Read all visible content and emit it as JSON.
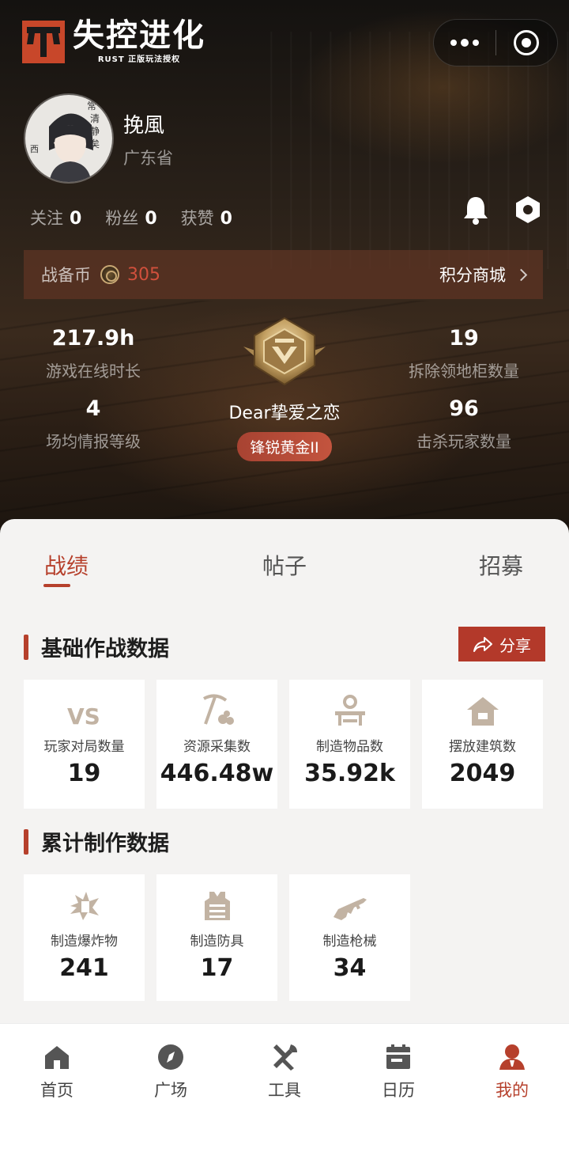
{
  "app": {
    "logo_title": "失控进化",
    "logo_subtitle": "RUST 正版玩法授权"
  },
  "profile": {
    "username": "挽風",
    "province": "广东省",
    "social": [
      {
        "label": "关注",
        "value": "0"
      },
      {
        "label": "粉丝",
        "value": "0"
      },
      {
        "label": "获赞",
        "value": "0"
      }
    ]
  },
  "coins": {
    "label": "战备币",
    "value": "305",
    "shop_label": "积分商城"
  },
  "stats": {
    "online_hours": {
      "value": "217.9h",
      "label": "游戏在线时长"
    },
    "cabinets": {
      "value": "19",
      "label": "拆除领地柜数量"
    },
    "intel_level": {
      "value": "4",
      "label": "场均情报等级"
    },
    "kills": {
      "value": "96",
      "label": "击杀玩家数量"
    }
  },
  "rank": {
    "name": "Dear挚爱之恋",
    "tier": "锋锐黄金II"
  },
  "tabs": [
    {
      "label": "战绩",
      "active": true
    },
    {
      "label": "帖子",
      "active": false
    },
    {
      "label": "招募",
      "active": false
    }
  ],
  "basic_section": {
    "title": "基础作战数据",
    "share_label": "分享",
    "cards": [
      {
        "icon": "vs-icon",
        "label": "玩家对局数量",
        "value": "19"
      },
      {
        "icon": "pickaxe-icon",
        "label": "资源采集数",
        "value": "446.48w"
      },
      {
        "icon": "workbench-icon",
        "label": "制造物品数",
        "value": "35.92k"
      },
      {
        "icon": "house-icon",
        "label": "摆放建筑数",
        "value": "2049"
      }
    ]
  },
  "craft_section": {
    "title": "累计制作数据",
    "cards": [
      {
        "icon": "explosive-icon",
        "label": "制造爆炸物",
        "value": "241"
      },
      {
        "icon": "armor-vest-icon",
        "label": "制造防具",
        "value": "17"
      },
      {
        "icon": "rifle-icon",
        "label": "制造枪械",
        "value": "34"
      }
    ]
  },
  "tabbar": [
    {
      "icon": "home-icon",
      "label": "首页",
      "active": false
    },
    {
      "icon": "compass-icon",
      "label": "广场",
      "active": false
    },
    {
      "icon": "tools-icon",
      "label": "工具",
      "active": false
    },
    {
      "icon": "calendar-icon",
      "label": "日历",
      "active": false
    },
    {
      "icon": "user-icon",
      "label": "我的",
      "active": true
    }
  ],
  "colors": {
    "accent": "#b6402c",
    "card_icon": "#c2b3a3",
    "coin_value": "#d0503c"
  }
}
